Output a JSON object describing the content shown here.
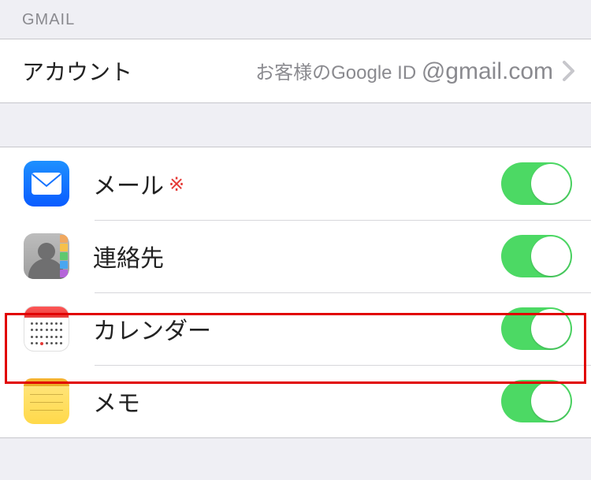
{
  "section_header": "GMAIL",
  "account": {
    "label": "アカウント",
    "value_prefix": "お客様のGoogle ID",
    "value_suffix": "@gmail.com"
  },
  "services": {
    "mail": {
      "label": "メール",
      "note_mark": "※",
      "enabled": true
    },
    "contacts": {
      "label": "連絡先",
      "enabled": true
    },
    "calendar": {
      "label": "カレンダー",
      "enabled": true,
      "highlighted": true
    },
    "notes": {
      "label": "メモ",
      "enabled": true
    }
  },
  "colors": {
    "toggle_on": "#4cd964",
    "highlight_border": "#e10000"
  },
  "contacts_tab_colors": [
    "#f0a860",
    "#f6c04a",
    "#5fc86f",
    "#4aa6f0",
    "#b565d9"
  ]
}
